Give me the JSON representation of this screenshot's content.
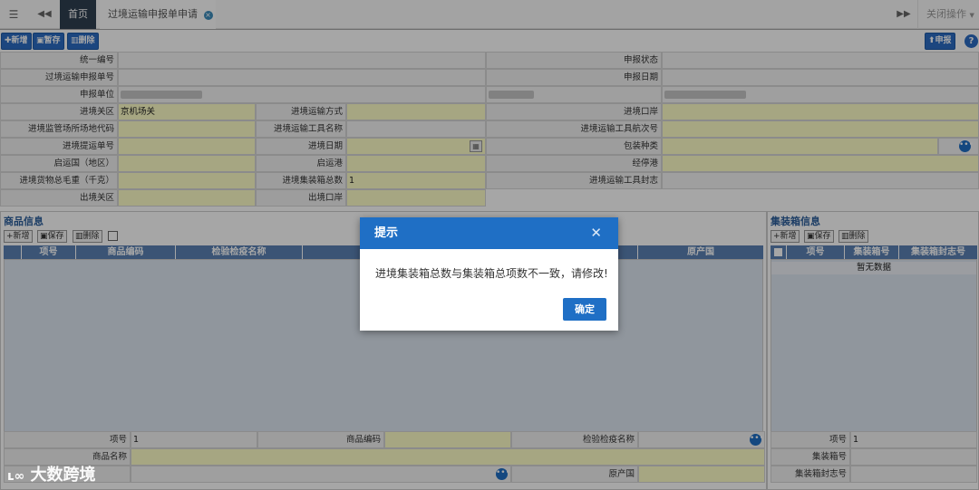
{
  "topbar": {
    "menu_icon": "menu-icon",
    "back_icon": "double-left-icon",
    "home_tab": "首页",
    "active_tab": "过境运输申报单申请",
    "forward_icon": "double-right-icon",
    "close_ops": "关闭操作"
  },
  "toolbar": {
    "add": "新增",
    "save": "暂存",
    "delete": "删除",
    "declare": "申报",
    "help": "?"
  },
  "form": {
    "r1": {
      "a": "统一编号",
      "b": "申报状态"
    },
    "r2": {
      "a": "过境运输申报单号",
      "b": "申报日期"
    },
    "r3": {
      "a": "申报单位"
    },
    "r4": {
      "a": "进境关区",
      "a_val": "京机场关",
      "b": "进境运输方式",
      "c": "进境口岸"
    },
    "r5": {
      "a": "进境监管场所场地代码",
      "b": "进境运输工具名称",
      "c": "进境运输工具航次号"
    },
    "r6": {
      "a": "进境提运单号",
      "b": "进境日期",
      "c": "包装种类"
    },
    "r7": {
      "a": "启运国（地区）",
      "b": "启运港",
      "c": "经停港"
    },
    "r8": {
      "a": "进境货物总毛重（千克）",
      "b": "进境集装箱总数",
      "b_val": "1",
      "c": "进境运输工具封志"
    },
    "r9": {
      "a": "出境关区",
      "b": "出境口岸"
    }
  },
  "goods": {
    "title": "商品信息",
    "add": "新增",
    "save": "保存",
    "delete": "删除",
    "cols": [
      "项号",
      "商品编码",
      "检验检疫名称",
      "原产国"
    ],
    "f_item_no": "项号",
    "f_item_no_val": "1",
    "f_hs_code": "商品编码",
    "f_inspection_name": "检验检疫名称",
    "f_goods_name": "商品名称",
    "f_origin": "原产国"
  },
  "container": {
    "title": "集装箱信息",
    "add": "新增",
    "save": "保存",
    "delete": "删除",
    "cols": [
      "项号",
      "集装箱号",
      "集装箱封志号"
    ],
    "empty": "暂无数据",
    "f_item_no": "项号",
    "f_item_no_val": "1",
    "f_container_no": "集装箱号",
    "f_seal_no": "集装箱封志号"
  },
  "dialog": {
    "title": "提示",
    "message": "进境集装箱总数与集装箱总项数不一致，请修改!",
    "ok": "确定"
  },
  "watermark": "大数跨境",
  "colors": {
    "accent": "#1f6fc5",
    "required_field": "#ffffc8",
    "header_dark": "#2f4050"
  }
}
